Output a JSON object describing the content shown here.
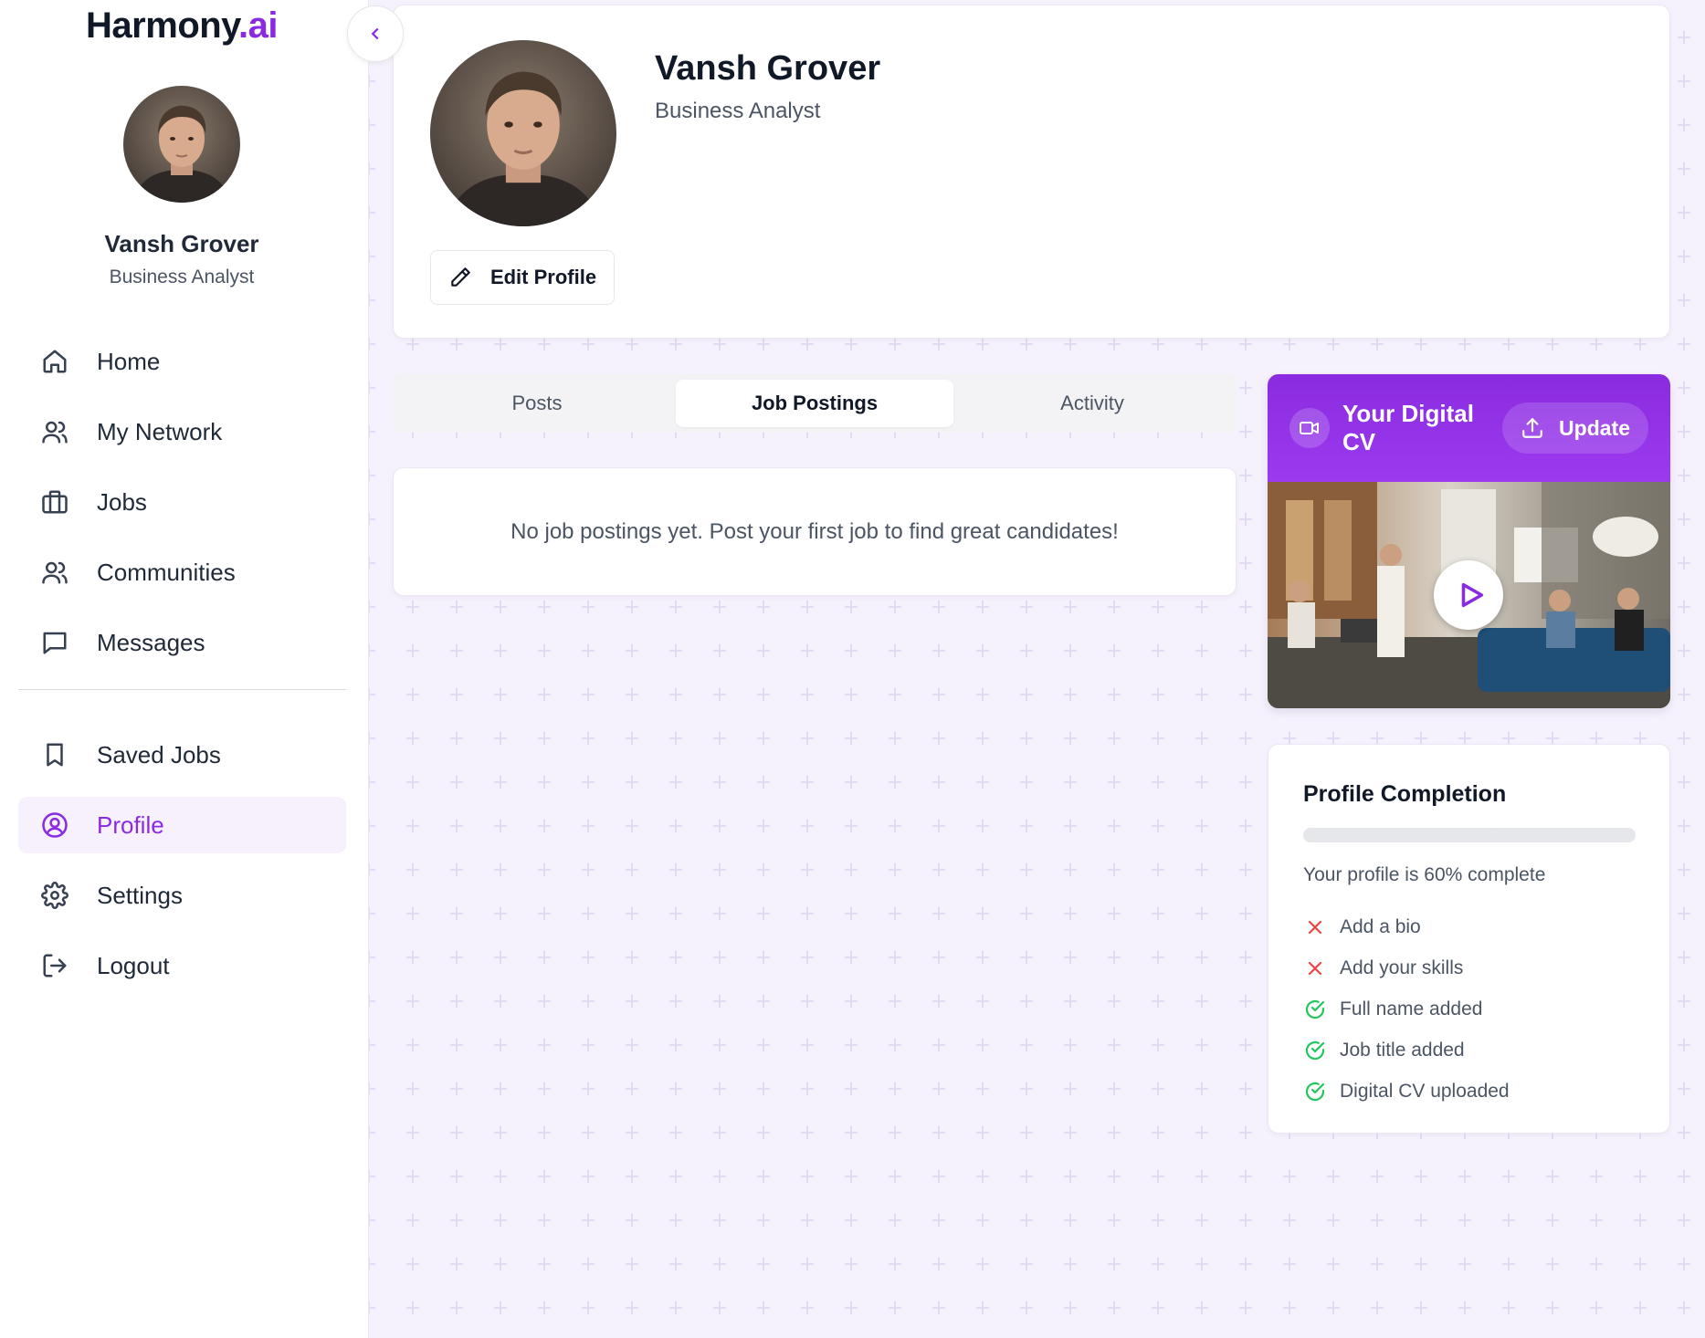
{
  "brand": {
    "name": "Harmony",
    "suffix": ".ai"
  },
  "user": {
    "name": "Vansh Grover",
    "role": "Business Analyst"
  },
  "sidebar": {
    "items": [
      {
        "label": "Home",
        "icon": "home-icon"
      },
      {
        "label": "My Network",
        "icon": "users-icon"
      },
      {
        "label": "Jobs",
        "icon": "briefcase-icon"
      },
      {
        "label": "Communities",
        "icon": "users-icon"
      },
      {
        "label": "Messages",
        "icon": "message-icon"
      }
    ],
    "secondary": [
      {
        "label": "Saved Jobs",
        "icon": "bookmark-icon"
      },
      {
        "label": "Profile",
        "icon": "user-circle-icon",
        "active": true
      },
      {
        "label": "Settings",
        "icon": "gear-icon"
      },
      {
        "label": "Logout",
        "icon": "logout-icon"
      }
    ]
  },
  "profile": {
    "edit_label": "Edit Profile"
  },
  "tabs": [
    {
      "label": "Posts"
    },
    {
      "label": "Job Postings",
      "active": true
    },
    {
      "label": "Activity"
    }
  ],
  "empty_state": "No job postings yet. Post your first job to find great candidates!",
  "digital_cv": {
    "title": "Your Digital CV",
    "update_label": "Update"
  },
  "completion": {
    "title": "Profile Completion",
    "percent": 60,
    "status_text": "Your profile is 60% complete",
    "items": [
      {
        "label": "Add a bio",
        "done": false
      },
      {
        "label": "Add your skills",
        "done": false
      },
      {
        "label": "Full name added",
        "done": true
      },
      {
        "label": "Job title added",
        "done": true
      },
      {
        "label": "Digital CV uploaded",
        "done": true
      }
    ]
  },
  "colors": {
    "accent": "#8a2be2",
    "background": "#f6f2fd",
    "success": "#22c55e",
    "error": "#ef4444"
  }
}
